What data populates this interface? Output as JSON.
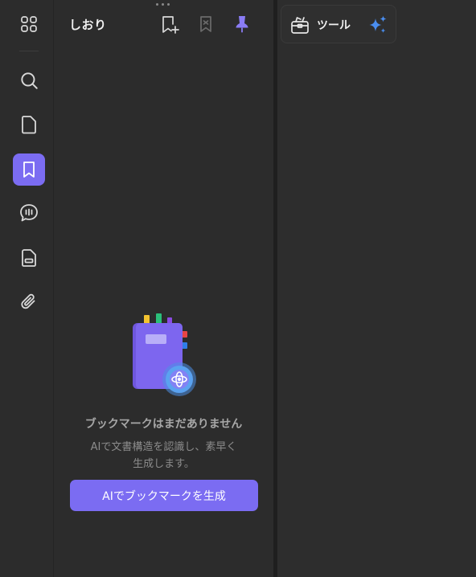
{
  "sidebar": {
    "items": [
      {
        "id": "apps",
        "icon": "grid-icon",
        "active": false
      },
      {
        "id": "search",
        "icon": "search-icon",
        "active": false
      },
      {
        "id": "pages",
        "icon": "page-icon",
        "active": false
      },
      {
        "id": "bookmarks",
        "icon": "bookmark-icon",
        "active": true
      },
      {
        "id": "comments",
        "icon": "comment-icon",
        "active": false
      },
      {
        "id": "forms",
        "icon": "form-icon",
        "active": false
      },
      {
        "id": "attachments",
        "icon": "paperclip-icon",
        "active": false
      }
    ]
  },
  "panel": {
    "title": "しおり",
    "header_icons": [
      "add-bookmark-icon",
      "bookmark-x-icon",
      "pin-icon"
    ],
    "empty_state": {
      "title": "ブックマークはまだありません",
      "description": "AIで文書構造を認識し、素早く\n生成します。",
      "button_label": "AIでブックマークを生成"
    }
  },
  "toolbar": {
    "tools_label": "ツール",
    "tools_icon": "toolbox-icon",
    "ai_icon": "sparkle-icon"
  },
  "colors": {
    "accent": "#7b6cf2",
    "background": "#2b2b2b",
    "ai_blue": "#4a8ef0"
  }
}
